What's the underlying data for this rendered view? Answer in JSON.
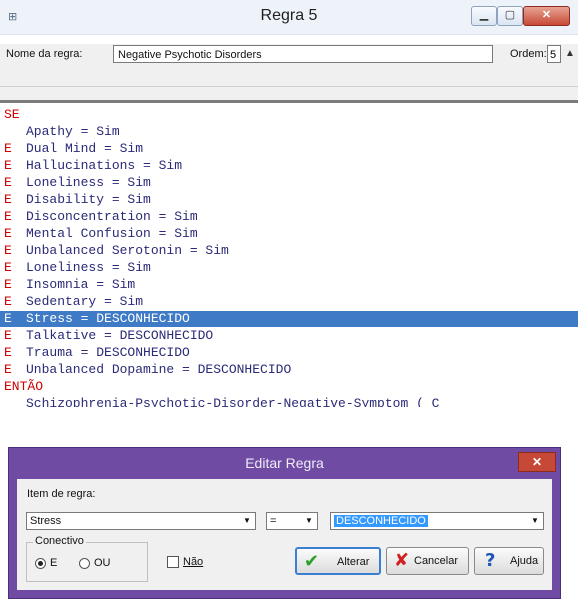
{
  "window": {
    "title": "Regra 5",
    "icon": "tree-icon",
    "controls": [
      "minimize-icon",
      "maximize-icon",
      "close-icon"
    ]
  },
  "header": {
    "name_label": "Nome da regra:",
    "name_value": "Negative Psychotic Disorders",
    "order_label": "Ordem:",
    "order_value": "5"
  },
  "rule": {
    "if_keyword": "SE",
    "conditions": [
      {
        "connector": "",
        "text": "Apathy = Sim"
      },
      {
        "connector": "E",
        "text": "Dual Mind = Sim"
      },
      {
        "connector": "E",
        "text": "Hallucinations = Sim"
      },
      {
        "connector": "E",
        "text": "Loneliness = Sim"
      },
      {
        "connector": "E",
        "text": "Disability = Sim"
      },
      {
        "connector": "E",
        "text": "Disconcentration = Sim"
      },
      {
        "connector": "E",
        "text": "Mental Confusion = Sim"
      },
      {
        "connector": "E",
        "text": "Unbalanced Serotonin = Sim"
      },
      {
        "connector": "E",
        "text": "Loneliness = Sim"
      },
      {
        "connector": "E",
        "text": "Insomnia = Sim"
      },
      {
        "connector": "E",
        "text": "Sedentary = Sim"
      },
      {
        "connector": "E",
        "text": "Stress = DESCONHECIDO",
        "selected": true
      },
      {
        "connector": "E",
        "text": "Talkative = DESCONHECIDO"
      },
      {
        "connector": "E",
        "text": "Trauma = DESCONHECIDO"
      },
      {
        "connector": "E",
        "text": "Unbalanced Dopamine = DESCONHECIDO"
      }
    ],
    "then_keyword": "ENTÃO",
    "conclusion": "Schizophrenia-Psychotic-Disorder-Negative-Symptom ( C"
  },
  "dialog": {
    "title": "Editar Regra",
    "item_label": "Item de regra:",
    "item_value": "Stress",
    "operator_value": "=",
    "value_value": "DESCONHECIDO",
    "connective_label": "Conectivo",
    "radio_e": "E",
    "radio_ou": "OU",
    "not_label": "Não",
    "alterar_label": "Alterar",
    "cancelar_label": "Cancelar",
    "ajuda_label": "Ajuda",
    "selected_connective": "E"
  }
}
